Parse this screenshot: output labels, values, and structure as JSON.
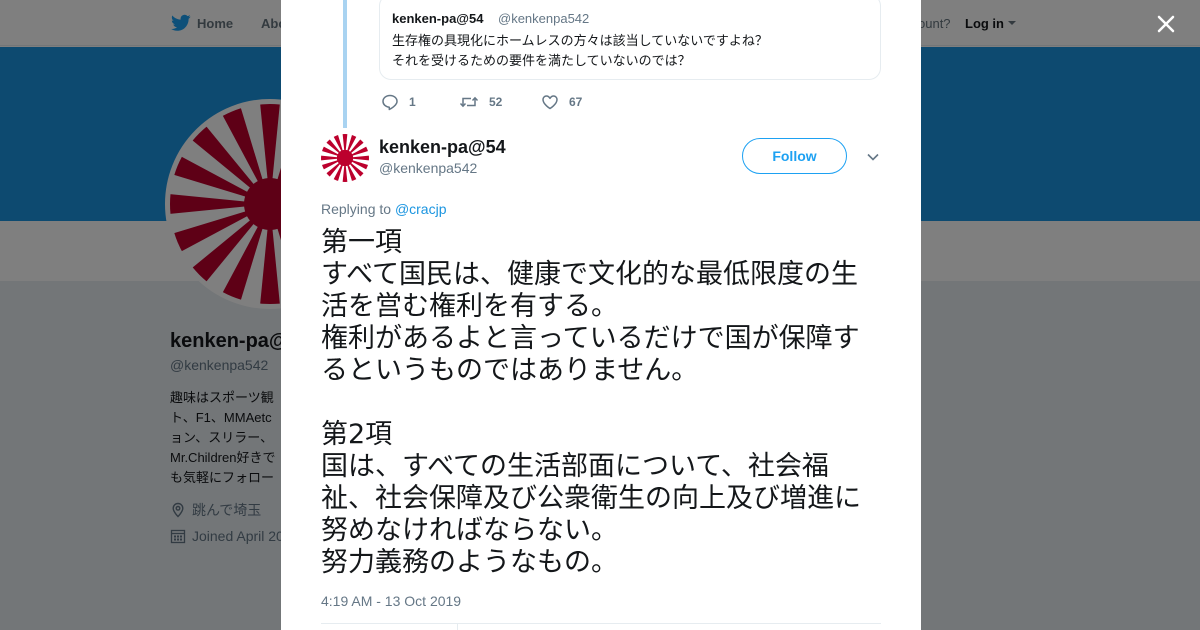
{
  "colors": {
    "brand_blue": "#1da1f2",
    "header_blue": "#1b95e0",
    "text_dark": "#14171a",
    "text_muted": "#657786",
    "rising_sun_red": "#bc002d"
  },
  "topnav": {
    "home_label": "Home",
    "about_label": "Abo",
    "account_prompt": "ccount?",
    "login_label": "Log in"
  },
  "profile": {
    "name": "kenken-pa@",
    "handle": "@kenkenpa542",
    "bio_lines": [
      "趣味はスポーツ観",
      "ト、F1、MMAetc",
      "ョン、スリラー、",
      "Mr.Children好きで",
      "も気軽にフォロー"
    ],
    "location": "跳んで埼玉",
    "joined": "Joined April 20"
  },
  "modal": {
    "close_icon": "close-x-icon",
    "quoted": {
      "name": "kenken-pa@54",
      "handle": "@kenkenpa542",
      "lines": [
        "生存権の具現化にホームレスの方々は該当していないですよね？",
        "それを受けるための要件を満たしていないのでは？"
      ]
    },
    "actions": {
      "replies": "1",
      "retweets": "52",
      "likes": "67"
    },
    "tweet": {
      "name": "kenken-pa@54",
      "handle": "@kenkenpa542",
      "follow_label": "Follow",
      "replying_prefix": "Replying to ",
      "replying_to": "@cracjp",
      "body_lines": [
        "第一項",
        "すべて国民は、健康で文化的な最低限度の生",
        "活を営む権利を有する。",
        "権利があるよと言っているだけで国が保障す",
        "るというものではありません。",
        "",
        "第2項",
        "国は、すべての生活部面について、社会福",
        "祉、社会保障及び公衆衛生の向上及び増進に",
        "努めなければならない。",
        "努力義務のようなもの。"
      ],
      "timestamp": "4:19 AM - 13 Oct 2019"
    }
  }
}
